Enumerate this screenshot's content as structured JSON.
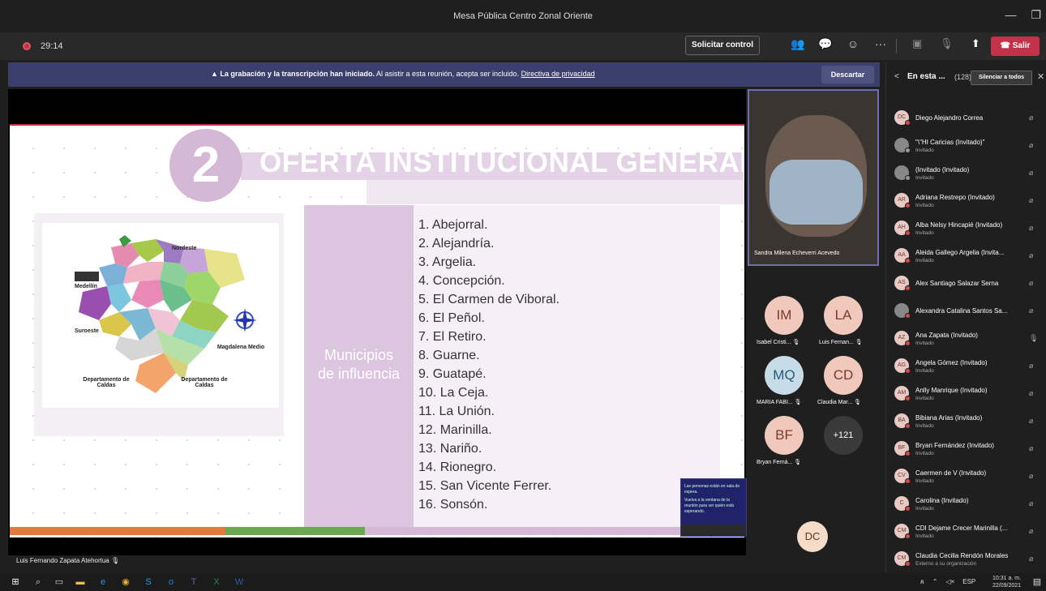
{
  "window": {
    "title": "Mesa Pública Centro Zonal Oriente",
    "minimize": "—",
    "maximize": "❐",
    "close": "✕"
  },
  "toolbar": {
    "timer": "29:14",
    "request_control": "Solicitar control",
    "participants_icon": "👥",
    "chat_icon": "💬",
    "reactions_icon": "☺",
    "more_icon": "···",
    "camera_icon": "▣",
    "mic_icon": "🎙",
    "share_icon": "⬆",
    "leave": "Salir"
  },
  "banner": {
    "bold": "La grabación y la transcripción han iniciado.",
    "text": " Al asistir a esta reunión, acepta ser incluido. ",
    "link": "Directiva de privacidad",
    "dismiss": "Descartar"
  },
  "slide": {
    "number": "2",
    "title": "OFERTA INSTITUCIONAL GENERAL",
    "map_labels": {
      "nordeste": "Nordeste",
      "medellin": "Medellín",
      "suroeste": "Suroeste",
      "magdalena": "Magdalena Medio",
      "dep_caldas_left": "Departamento de Caldas",
      "dep_caldas_right": "Departamento de Caldas"
    },
    "muni_label_1": "Municipios",
    "muni_label_2": "de influencia",
    "municipalities": [
      "1.   Abejorral.",
      "2.   Alejandría.",
      "3.   Argelia.",
      "4.   Concepción.",
      "5.   El Carmen de Viboral.",
      "6.   El Peñol.",
      "7.   El Retiro.",
      "8.   Guarne.",
      "9.   Guatapé.",
      "10. La Ceja.",
      "11. La Unión.",
      "12. Marinilla.",
      "13. Nariño.",
      "14. Rionegro.",
      "15. San Vicente Ferrer.",
      "16. Sonsón."
    ]
  },
  "speaker_tile": {
    "name": "Sandra Milena Echeverri Acevedo"
  },
  "tiles": [
    {
      "initials": "IM",
      "name": "Isabel Cristi..."
    },
    {
      "initials": "LA",
      "name": "Luis Fernan..."
    },
    {
      "initials": "MQ",
      "name": "MARIA FABI..."
    },
    {
      "initials": "CD",
      "name": "Claudia Mar..."
    },
    {
      "initials": "BF",
      "name": "Bryan Ferná..."
    },
    {
      "initials": "+121",
      "name": ""
    },
    {
      "initials": "DC",
      "name": ""
    }
  ],
  "toast": {
    "line1": "Las personas están en sala de espera.",
    "line2": "Vuelva a la ventana de la reunión para ver quién está esperando."
  },
  "presenter_name": "Luis Fernando Zapata Atehortua",
  "panel": {
    "back": "<",
    "title": "En esta ...",
    "count": "(128)",
    "mute_all": "Silenciar a todos",
    "close": "✕",
    "participants": [
      {
        "initials": "DC",
        "name": "Diego Alejandro Correa",
        "sub": "",
        "mic": "muted"
      },
      {
        "initials": "",
        "name": "\"\\\"HI Caricias (Invitado)\"",
        "sub": "Invitado",
        "mic": "muted"
      },
      {
        "initials": "",
        "name": "(Invitado (Invitado)",
        "sub": "Invitado",
        "mic": "muted"
      },
      {
        "initials": "AR",
        "name": "Adriana Restrepo (Invitado)",
        "sub": "Invitado",
        "mic": "muted"
      },
      {
        "initials": "AH",
        "name": "Alba Nelsy Hincapié (Invitado)",
        "sub": "Invitado",
        "mic": "muted"
      },
      {
        "initials": "AA",
        "name": "Aleida Gallego Argelia (Invita...",
        "sub": "Invitado",
        "mic": "muted"
      },
      {
        "initials": "AS",
        "name": "Alex Santiago Salazar Serna",
        "sub": "",
        "mic": "muted"
      },
      {
        "initials": "",
        "name": "Alexandra Catalina Santos Sa...",
        "sub": "",
        "mic": "muted"
      },
      {
        "initials": "AZ",
        "name": "Ana Zapata (Invitado)",
        "sub": "Invitado",
        "mic": "on"
      },
      {
        "initials": "AG",
        "name": "Angela Gómez (Invitado)",
        "sub": "Invitado",
        "mic": "muted"
      },
      {
        "initials": "AM",
        "name": "Anlly Manrique (Invitado)",
        "sub": "Invitado",
        "mic": "muted"
      },
      {
        "initials": "BA",
        "name": "Bibiana Arias (Invitado)",
        "sub": "Invitado",
        "mic": "muted"
      },
      {
        "initials": "BF",
        "name": "Bryan Fernández (Invitado)",
        "sub": "Invitado",
        "mic": "muted"
      },
      {
        "initials": "CV",
        "name": "Caermen de V (Invitado)",
        "sub": "Invitado",
        "mic": "muted"
      },
      {
        "initials": "C",
        "name": "Carolina (Invitado)",
        "sub": "Invitado",
        "mic": "muted"
      },
      {
        "initials": "CM",
        "name": "CDI Dejame Crecer Marinilla (...",
        "sub": "Invitado",
        "mic": "muted"
      },
      {
        "initials": "CM",
        "name": "Claudia Cecilia Rendón Morales",
        "sub": "Externo a su organización",
        "mic": "muted"
      }
    ]
  },
  "taskbar": {
    "lang": "ESP",
    "time": "10:31 a. m.",
    "date": "22/09/2021"
  },
  "colors": {
    "leave": "#c4314b",
    "banner": "#3b3f6b",
    "slide_accent": "#d4b8d6"
  }
}
